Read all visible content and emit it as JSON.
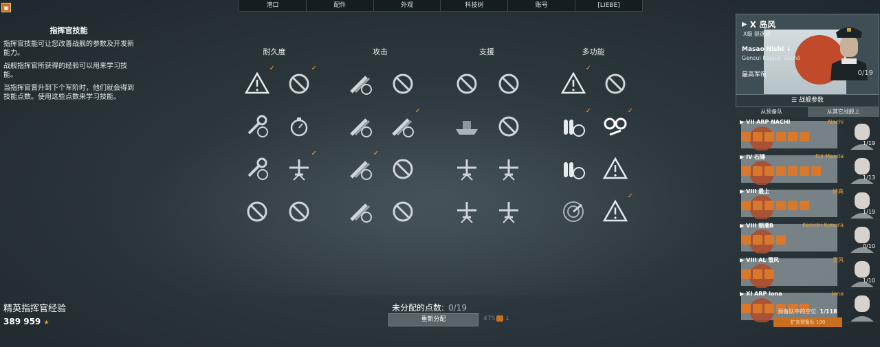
{
  "nav": {
    "tabs": [
      "港口",
      "配件",
      "外观",
      "科技树",
      "账号",
      "[LIEBE]"
    ]
  },
  "left": {
    "title": "指挥官技能",
    "p1": "指挥官技能可让您改善战舰的参数及开发新能力。",
    "p2": "战舰指挥官所获得的经验可以用来学习技能。",
    "p3": "当指挥官晋升到下个军阶时，他们就会得到技能点数。使用这些点数来学习技能。",
    "xp_label": "精英指挥官经验",
    "xp_value": "389 959"
  },
  "categories": [
    "耐久度",
    "攻击",
    "支援",
    "多功能"
  ],
  "bottom": {
    "unassigned_label": "未分配的点数:",
    "unassigned_value": "0/19",
    "reset_label": "重新分配",
    "cost": "475"
  },
  "commander": {
    "ship_name": "X 岛风",
    "ship_sub": "X级  驱逐舰",
    "name": "Masao Nishi",
    "rank": "Gensui Kaigun Taishō",
    "title": "最高军衔",
    "points": "0/19",
    "ship_params": "战舰参数"
  },
  "roster_tabs": [
    "从预备队",
    "从其它战舰上"
  ],
  "cards": [
    {
      "tier": "VII ARP NACHI",
      "name": "Nachi",
      "points": "1/19"
    },
    {
      "tier": "IV 石锤",
      "name": "Eiji Maeda",
      "points": "1/13"
    },
    {
      "tier": "VIII 最上",
      "name": "妙高",
      "points": "1/19"
    },
    {
      "tier": "VIII 朝潮B",
      "name": "Kenichi Kimura",
      "points": "0/10"
    },
    {
      "tier": "VIII AL 雪风",
      "name": "雪风",
      "points": "1/10"
    },
    {
      "tier": "XI ARP Iona",
      "name": "Iona",
      "points": ""
    }
  ],
  "reserve": {
    "label": "预备队中的空位:",
    "value": "1/118",
    "buy": "扩充预备队  100"
  },
  "colors": {
    "accent": "#f0a030",
    "orange": "#d9782b",
    "panel": "#3f4e55"
  }
}
